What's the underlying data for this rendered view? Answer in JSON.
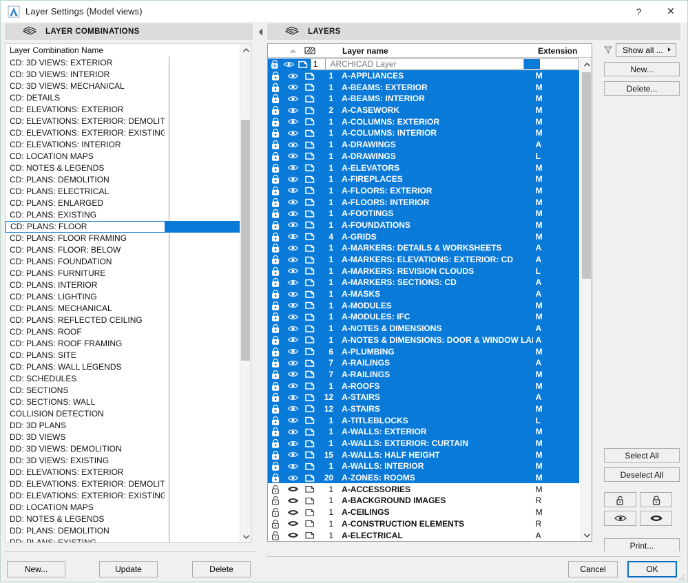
{
  "window": {
    "title": "Layer Settings (Model views)",
    "icon": "archicad-logo-icon",
    "help_label": "?",
    "close_label": "✕"
  },
  "left_panel": {
    "header": {
      "label": "LAYER COMBINATIONS",
      "icon": "layers-stack-icon"
    },
    "column_header": "Layer Combination Name",
    "selected": "CD: PLANS: FLOOR",
    "items": [
      "CD: 3D VIEWS: EXTERIOR",
      "CD: 3D VIEWS: INTERIOR",
      "CD: 3D VIEWS: MECHANICAL",
      "CD: DETAILS",
      "CD: ELEVATIONS: EXTERIOR",
      "CD: ELEVATIONS: EXTERIOR: DEMOLITION",
      "CD: ELEVATIONS: EXTERIOR: EXISTING",
      "CD: ELEVATIONS: INTERIOR",
      "CD: LOCATION MAPS",
      "CD: NOTES & LEGENDS",
      "CD: PLANS: DEMOLITION",
      "CD: PLANS: ELECTRICAL",
      "CD: PLANS: ENLARGED",
      "CD: PLANS: EXISTING",
      "CD: PLANS: FLOOR",
      "CD: PLANS: FLOOR FRAMING",
      "CD: PLANS: FLOOR: BELOW",
      "CD: PLANS: FOUNDATION",
      "CD: PLANS: FURNITURE",
      "CD: PLANS: INTERIOR",
      "CD: PLANS: LIGHTING",
      "CD: PLANS: MECHANICAL",
      "CD: PLANS: REFLECTED CEILING",
      "CD: PLANS: ROOF",
      "CD: PLANS: ROOF FRAMING",
      "CD: PLANS: SITE",
      "CD: PLANS: WALL LEGENDS",
      "CD: SCHEDULES",
      "CD: SECTIONS",
      "CD: SECTIONS: WALL",
      "COLLISION DETECTION",
      "DD: 3D PLANS",
      "DD: 3D VIEWS",
      "DD: 3D VIEWS: DEMOLITION",
      "DD: 3D VIEWS: EXISTING",
      "DD: ELEVATIONS: EXTERIOR",
      "DD: ELEVATIONS: EXTERIOR: DEMOLITION",
      "DD: ELEVATIONS: EXTERIOR: EXISTING",
      "DD: LOCATION MAPS",
      "DD: NOTES & LEGENDS",
      "DD: PLANS: DEMOLITION",
      "DD: PLANS: EXISTING"
    ]
  },
  "right_panel": {
    "header": {
      "label": "LAYERS",
      "icon": "layers-stack-icon"
    },
    "columns": {
      "lock": "lock-column",
      "visibility": "eye-column",
      "wireframe": "wireframe-column",
      "sort": "sort-ascending-icon",
      "name": "Layer name",
      "extension": "Extension"
    },
    "edit_row": {
      "number": "1",
      "name": "ARCHICAD Layer",
      "extension": ""
    },
    "rows": [
      {
        "n": "1",
        "name": "A-APPLIANCES",
        "ext": "M",
        "sel": true
      },
      {
        "n": "1",
        "name": "A-BEAMS: EXTERIOR",
        "ext": "M",
        "sel": true
      },
      {
        "n": "1",
        "name": "A-BEAMS: INTERIOR",
        "ext": "M",
        "sel": true
      },
      {
        "n": "2",
        "name": "A-CASEWORK",
        "ext": "M",
        "sel": true
      },
      {
        "n": "1",
        "name": "A-COLUMNS: EXTERIOR",
        "ext": "M",
        "sel": true
      },
      {
        "n": "1",
        "name": "A-COLUMNS: INTERIOR",
        "ext": "M",
        "sel": true
      },
      {
        "n": "1",
        "name": "A-DRAWINGS",
        "ext": "A",
        "sel": true
      },
      {
        "n": "1",
        "name": "A-DRAWINGS",
        "ext": "L",
        "sel": true
      },
      {
        "n": "1",
        "name": "A-ELEVATORS",
        "ext": "M",
        "sel": true
      },
      {
        "n": "1",
        "name": "A-FIREPLACES",
        "ext": "M",
        "sel": true
      },
      {
        "n": "1",
        "name": "A-FLOORS: EXTERIOR",
        "ext": "M",
        "sel": true
      },
      {
        "n": "1",
        "name": "A-FLOORS: INTERIOR",
        "ext": "M",
        "sel": true
      },
      {
        "n": "1",
        "name": "A-FOOTINGS",
        "ext": "M",
        "sel": true
      },
      {
        "n": "1",
        "name": "A-FOUNDATIONS",
        "ext": "M",
        "sel": true
      },
      {
        "n": "4",
        "name": "A-GRIDS",
        "ext": "M",
        "sel": true
      },
      {
        "n": "1",
        "name": "A-MARKERS: DETAILS & WORKSHEETS",
        "ext": "A",
        "sel": true
      },
      {
        "n": "1",
        "name": "A-MARKERS: ELEVATIONS: EXTERIOR: CD",
        "ext": "A",
        "sel": true
      },
      {
        "n": "1",
        "name": "A-MARKERS: REVISION CLOUDS",
        "ext": "L",
        "sel": true
      },
      {
        "n": "1",
        "name": "A-MARKERS: SECTIONS: CD",
        "ext": "A",
        "sel": true
      },
      {
        "n": "1",
        "name": "A-MASKS",
        "ext": "A",
        "sel": true
      },
      {
        "n": "1",
        "name": "A-MODULES",
        "ext": "M",
        "sel": true
      },
      {
        "n": "1",
        "name": "A-MODULES: IFC",
        "ext": "M",
        "sel": true
      },
      {
        "n": "1",
        "name": "A-NOTES & DIMENSIONS",
        "ext": "A",
        "sel": true
      },
      {
        "n": "1",
        "name": "A-NOTES & DIMENSIONS: DOOR & WINDOW LABELS",
        "ext": "A",
        "sel": true
      },
      {
        "n": "6",
        "name": "A-PLUMBING",
        "ext": "M",
        "sel": true
      },
      {
        "n": "7",
        "name": "A-RAILINGS",
        "ext": "A",
        "sel": true
      },
      {
        "n": "7",
        "name": "A-RAILINGS",
        "ext": "M",
        "sel": true
      },
      {
        "n": "1",
        "name": "A-ROOFS",
        "ext": "M",
        "sel": true
      },
      {
        "n": "12",
        "name": "A-STAIRS",
        "ext": "A",
        "sel": true
      },
      {
        "n": "12",
        "name": "A-STAIRS",
        "ext": "M",
        "sel": true
      },
      {
        "n": "1",
        "name": "A-TITLEBLOCKS",
        "ext": "L",
        "sel": true
      },
      {
        "n": "1",
        "name": "A-WALLS: EXTERIOR",
        "ext": "M",
        "sel": true
      },
      {
        "n": "1",
        "name": "A-WALLS: EXTERIOR: CURTAIN",
        "ext": "M",
        "sel": true
      },
      {
        "n": "15",
        "name": "A-WALLS: HALF HEIGHT",
        "ext": "M",
        "sel": true
      },
      {
        "n": "1",
        "name": "A-WALLS: INTERIOR",
        "ext": "M",
        "sel": true
      },
      {
        "n": "20",
        "name": "A-ZONES: ROOMS",
        "ext": "M",
        "sel": true
      },
      {
        "n": "1",
        "name": "A-ACCESSORIES",
        "ext": "M",
        "sel": false
      },
      {
        "n": "1",
        "name": "A-BACKGROUND IMAGES",
        "ext": "R",
        "sel": false
      },
      {
        "n": "1",
        "name": "A-CEILINGS",
        "ext": "M",
        "sel": false
      },
      {
        "n": "1",
        "name": "A-CONSTRUCTION ELEMENTS",
        "ext": "R",
        "sel": false
      },
      {
        "n": "1",
        "name": "A-ELECTRICAL",
        "ext": "A",
        "sel": false
      }
    ]
  },
  "rail": {
    "filter_icon": "funnel-filter-icon",
    "show_all": "Show all ...",
    "new_button": "New...",
    "delete_button": "Delete...",
    "select_all": "Select All",
    "deselect_all": "Deselect All",
    "unlock_icon": "unlock-icon",
    "lock_icon": "lock-icon",
    "show_icon": "eye-open-icon",
    "hide_icon": "eye-closed-icon",
    "print_button": "Print..."
  },
  "footer": {
    "new_button": "New...",
    "update_button": "Update",
    "delete_button": "Delete",
    "cancel_button": "Cancel",
    "ok_button": "OK"
  },
  "colors": {
    "selection_blue": "#0a7ad8",
    "panel_header_gray": "#dcdcdc",
    "window_bg": "#f0f0f0",
    "primary_border": "#0a6cc4"
  }
}
